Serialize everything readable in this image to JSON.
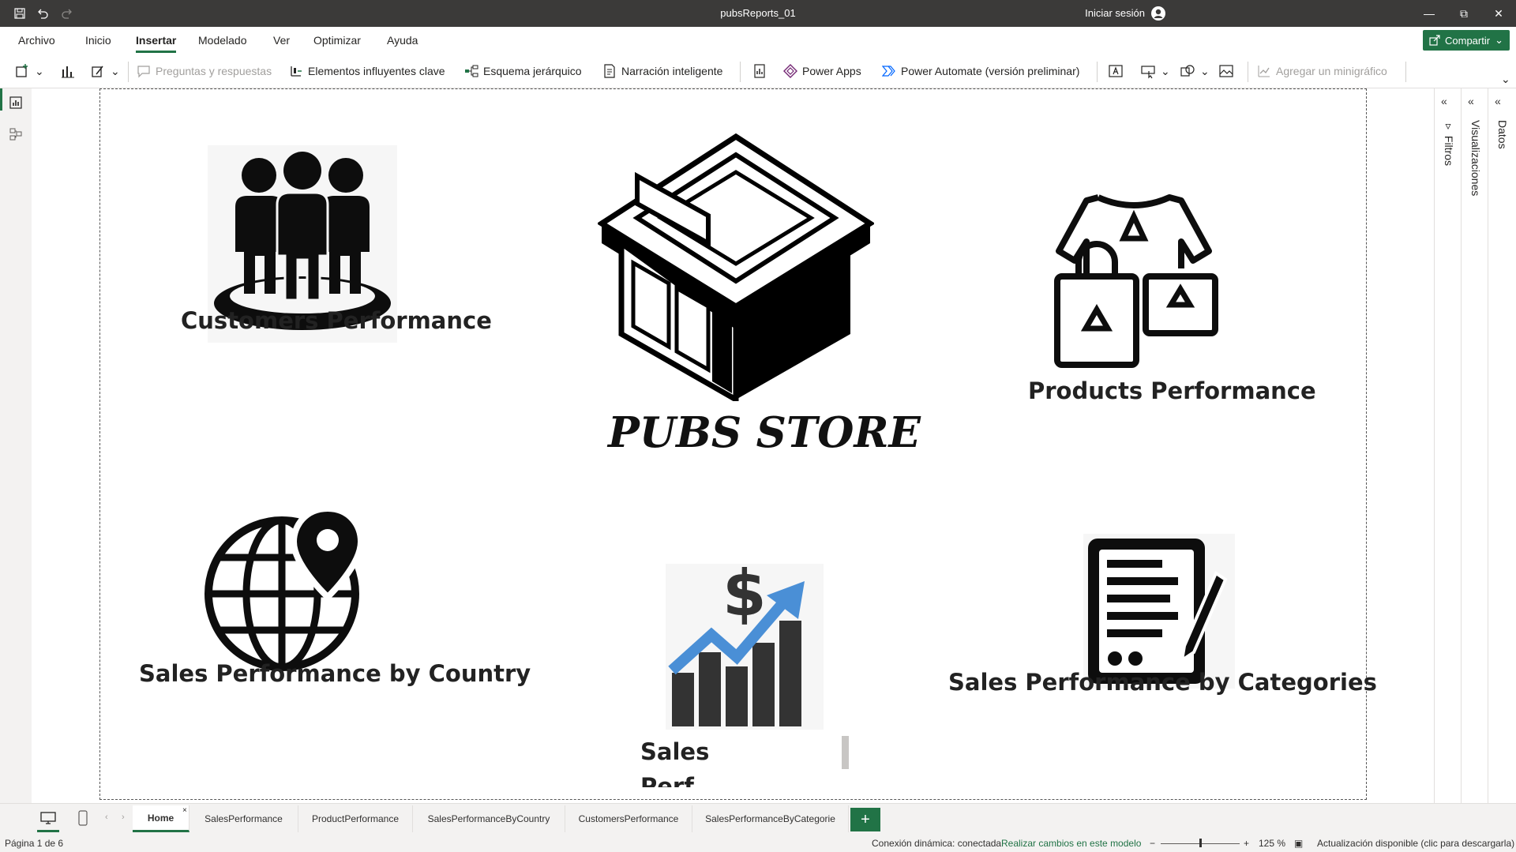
{
  "window": {
    "title": "pubsReports_01",
    "signin": "Iniciar sesión"
  },
  "menu": {
    "items": [
      "Archivo",
      "Inicio",
      "Insertar",
      "Modelado",
      "Ver",
      "Optimizar",
      "Ayuda"
    ],
    "active": "Insertar",
    "share_label": "Compartir"
  },
  "ribbon": {
    "qa": "Preguntas y respuestas",
    "key_influencers": "Elementos influyentes clave",
    "decomposition_tree": "Esquema jerárquico",
    "smart_narrative": "Narración inteligente",
    "power_apps": "Power Apps",
    "power_automate": "Power Automate (versión preliminar)",
    "sparkline": "Agregar un minigráfico"
  },
  "report": {
    "store_title": "PUBS STORE",
    "cards": {
      "customers": "Customers Performance",
      "products": "Products Performance",
      "country": "Sales Performance by Country",
      "sales_line1": "Sales",
      "sales_line2": "Perf",
      "categories": "Sales Performance by Categories"
    }
  },
  "panes": {
    "filters": "Filtros",
    "visualizations": "Visualizaciones",
    "data": "Datos"
  },
  "tabs": [
    "Home",
    "SalesPerformance",
    "ProductPerformance",
    "SalesPerformanceByCountry",
    "CustomersPerformance",
    "SalesPerformanceByCategorie"
  ],
  "status": {
    "page": "Página 1 de 6",
    "connection": "Conexión dinámica: conectada",
    "model_link": "Realizar cambios en este modelo",
    "zoom": "125 %",
    "update": "Actualización disponible (clic para descargarla)"
  },
  "colors": {
    "accent": "#217346",
    "chart_arrow": "#4a8fd6"
  }
}
